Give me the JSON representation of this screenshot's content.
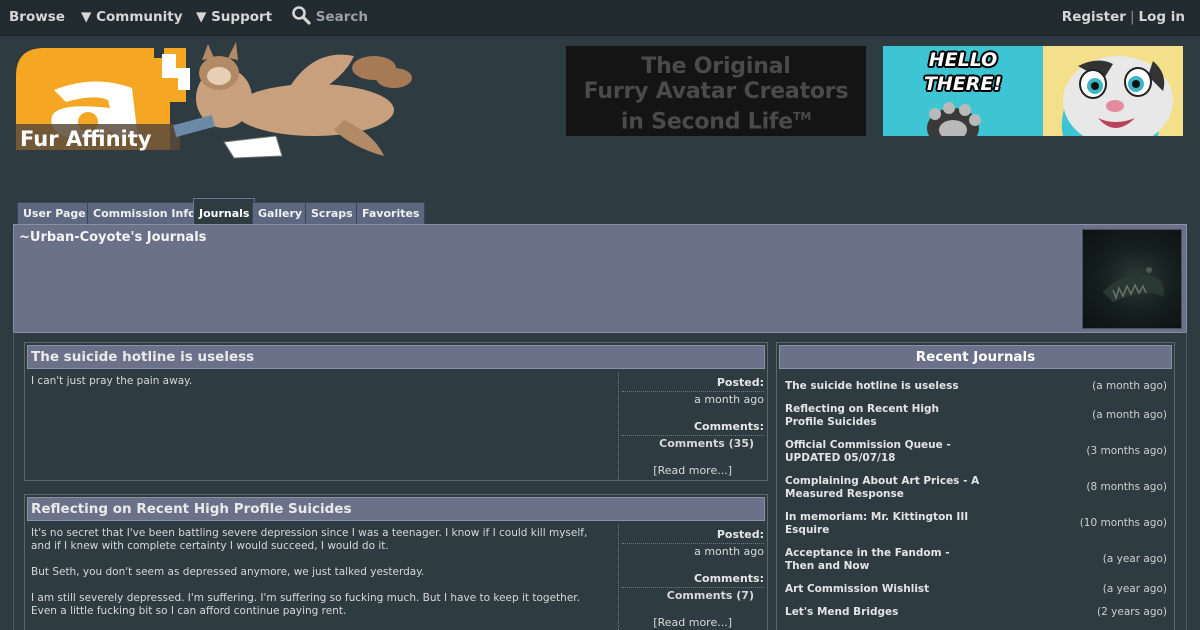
{
  "nav": {
    "browse": "Browse",
    "community": "▼ Community",
    "support": "▼ Support",
    "search": "Search",
    "register": "Register",
    "separator": "|",
    "login": "Log in"
  },
  "logo": {
    "text": "Fur Affinity"
  },
  "banners": {
    "left_line1": "The Original",
    "left_line2": "Furry Avatar Creators",
    "left_line3": "in Second Life",
    "left_tm": "TM",
    "right_line1": "HELLO",
    "right_line2": "THERE!"
  },
  "tabs": [
    {
      "label": "User Page"
    },
    {
      "label": "Commission Info"
    },
    {
      "label": "Journals"
    },
    {
      "label": "Gallery"
    },
    {
      "label": "Scraps"
    },
    {
      "label": "Favorites"
    }
  ],
  "header": {
    "title": "~Urban-Coyote's Journals"
  },
  "journals": [
    {
      "title": "The suicide hotline is useless",
      "body": [
        "I can't just pray the pain away."
      ],
      "posted_label": "Posted:",
      "posted": "a month ago",
      "comments_label": "Comments:",
      "comments": "Comments (35)",
      "read_more": "[Read more...]"
    },
    {
      "title": "Reflecting on Recent High Profile Suicides",
      "body": [
        "It's no secret that I've been battling severe depression since I was a teenager. I know if I could kill myself, and if I knew with complete certainty I would succeed, I would do it.",
        "But Seth, you don't seem as depressed anymore, we just talked yesterday.",
        "I am still severely depressed. I'm suffering. I'm suffering so fucking much. But I have to keep it together. Even a little fucking bit so I can afford continue paying rent."
      ],
      "posted_label": "Posted:",
      "posted": "a month ago",
      "comments_label": "Comments:",
      "comments": "Comments (7)",
      "read_more": "[Read more...]"
    }
  ],
  "recent": {
    "title": "Recent Journals",
    "items": [
      {
        "name": "The suicide hotline is useless",
        "time": "(a month ago)"
      },
      {
        "name": "Reflecting on Recent High Profile Suicides",
        "time": "(a month ago)"
      },
      {
        "name": "Official Commission Queue - UPDATED 05/07/18",
        "time": "(3 months ago)"
      },
      {
        "name": "Complaining About Art Prices - A Measured Response",
        "time": "(8 months ago)"
      },
      {
        "name": "In memoriam: Mr. Kittington III Esquire",
        "time": "(10 months ago)"
      },
      {
        "name": "Acceptance in the Fandom - Then and Now",
        "time": "(a year ago)"
      },
      {
        "name": "Art Commission Wishlist",
        "time": "(a year ago)"
      },
      {
        "name": "Let's Mend Bridges",
        "time": "(2 years ago)"
      }
    ]
  },
  "colors": {
    "background": "#2e3b41",
    "nav": "#222b2f",
    "panel": "#6b7189",
    "tab": "#5d6780",
    "logo_orange": "#f5a623",
    "banner_teal": "#3ec5d3"
  }
}
